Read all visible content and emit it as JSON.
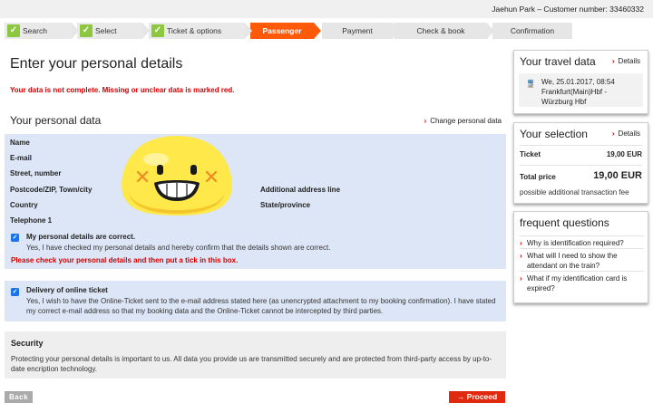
{
  "header": {
    "customer": "Jaehun Park – Customer number: 33460332"
  },
  "steps": [
    {
      "label": "Search",
      "state": "done"
    },
    {
      "label": "Select",
      "state": "done"
    },
    {
      "label": "Ticket & options",
      "state": "done"
    },
    {
      "label": "Passenger",
      "state": "active"
    },
    {
      "label": "Payment",
      "state": "todo"
    },
    {
      "label": "Check & book",
      "state": "todo"
    },
    {
      "label": "Confirmation",
      "state": "todo"
    }
  ],
  "main": {
    "title": "Enter your personal details",
    "error": "Your data is not complete. Missing or unclear data is marked red.",
    "personal": {
      "title": "Your personal data",
      "change_link": "Change personal data",
      "fields": {
        "name": "Name",
        "email": "E-mail",
        "street": "Street, number",
        "postcode": "Postcode/ZIP, Town/city",
        "additional": "Additional address line",
        "country": "Country",
        "state": "State/province",
        "telephone": "Telephone 1"
      }
    },
    "confirm": {
      "title": "My personal details are correct.",
      "text": "Yes, I have checked my personal details and hereby confirm that the details shown are correct.",
      "error": "Please check your personal details and then put a tick in this box."
    },
    "delivery": {
      "title": "Delivery of online ticket",
      "text": "Yes, I wish to have the Online-Ticket sent to the e-mail address stated here (as unencrypted attachment to my booking confirmation). I have stated my correct e-mail address so that my booking data and the Online-Ticket cannot be intercepted by third parties."
    },
    "security": {
      "title": "Security",
      "text": "Protecting your personal details is important to us. All data you provide us are transmitted securely and are protected from third-party access by up-to-date encription technology."
    },
    "buttons": {
      "back": "Back",
      "proceed": "Proceed"
    }
  },
  "sidebar": {
    "travel": {
      "title": "Your travel data",
      "link": "Details",
      "date": "We, 25.01.2017, 08:54",
      "route": "Frankfurt(Main)Hbf -",
      "route2": "Würzburg Hbf"
    },
    "selection": {
      "title": "Your selection",
      "link": "Details",
      "ticket_label": "Ticket",
      "ticket_price": "19,00 EUR",
      "total_label": "Total price",
      "total_price": "19,00 EUR",
      "note": "possible additional transaction fee"
    },
    "faq": {
      "title": "frequent questions",
      "items": [
        "Why is identification required?",
        "What will I need to show the attendant on the train?",
        "What if my identification card is expired?"
      ]
    }
  },
  "colors": {
    "accent": "#ff5a0a",
    "error": "#d40000",
    "check": "#8dc63f",
    "form_bg": "#dde6f6",
    "checkbox": "#1a73e8"
  }
}
